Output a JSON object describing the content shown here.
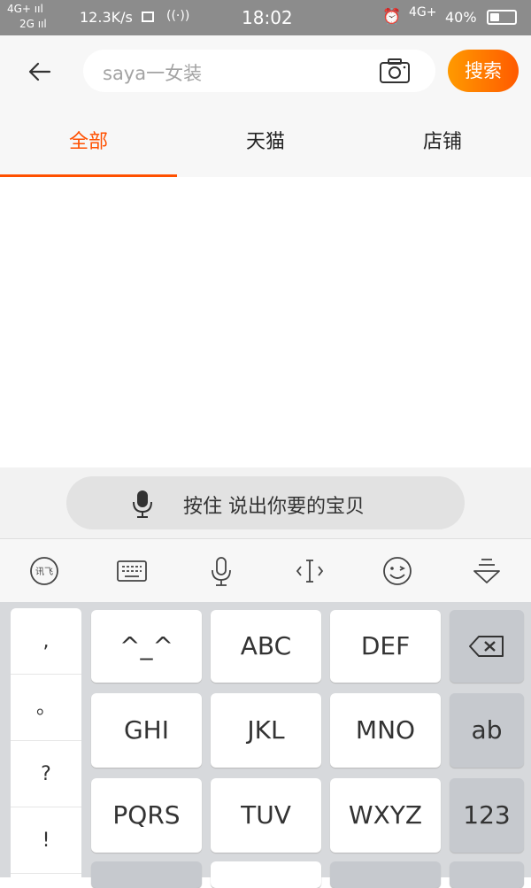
{
  "status_bar": {
    "network_top": "4G+ ııl",
    "network_bottom": "2G ııl",
    "speed": "12.3K/s",
    "time": "18:02",
    "network_right": "4G+",
    "battery_percent": "40%",
    "battery_level": 0.4
  },
  "header": {
    "search_placeholder": "saya一女装",
    "search_button": "搜索"
  },
  "tabs": [
    {
      "label": "全部",
      "active": true
    },
    {
      "label": "天猫",
      "active": false
    },
    {
      "label": "店铺",
      "active": false
    }
  ],
  "voice": {
    "label": "按住 说出你要的宝贝"
  },
  "ime_toolbar": {
    "icons": [
      "ime-logo-icon",
      "keyboard-icon",
      "microphone-icon",
      "cursor-move-icon",
      "emoji-icon",
      "hide-keyboard-icon"
    ],
    "logo_text": "讯飞"
  },
  "keyboard": {
    "punctuation": [
      ",",
      "。",
      "?",
      "!"
    ],
    "rows": [
      [
        "^_^",
        "ABC",
        "DEF"
      ],
      [
        "GHI",
        "JKL",
        "MNO"
      ],
      [
        "PQRS",
        "TUV",
        "WXYZ"
      ]
    ],
    "side_keys": {
      "delete": "delete-icon",
      "ab": "ab",
      "num": "123"
    }
  },
  "colors": {
    "accent": "#ff5000",
    "button_gradient_start": "#ff9a00",
    "button_gradient_end": "#ff5a00",
    "status_bar": "#8c8c8c"
  }
}
